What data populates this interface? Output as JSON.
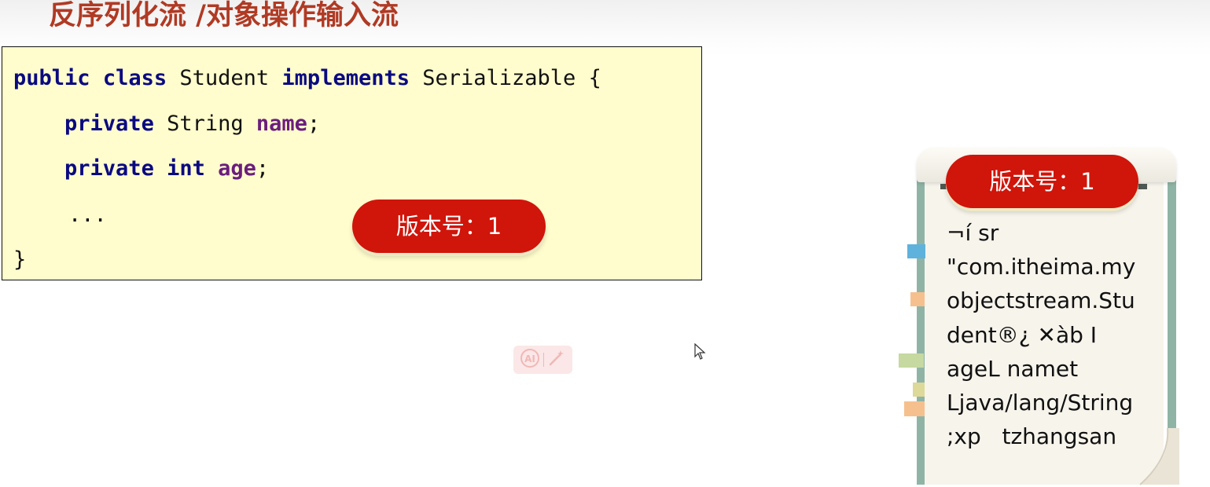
{
  "title": "反序列化流 /对象操作输入流",
  "code": {
    "line1": {
      "kw1": "public",
      "kw2": "class",
      "name": "Student",
      "kw3": "implements",
      "iface": "Serializable",
      "brace": "{"
    },
    "line2": {
      "kw": "private",
      "type": "String",
      "field": "name",
      "semi": ";"
    },
    "line3": {
      "kw": "private",
      "type": "int",
      "field": "age",
      "semi": ";"
    },
    "line4": "...",
    "line5": "}"
  },
  "version_badge": "版本号：1",
  "ai_toolbar": {
    "ai_icon": "ai-icon",
    "magic_icon": "magic-wand-icon"
  },
  "serialized_lines": [
    "¬í sr",
    "\"com.itheima.my",
    "objectstream.Stu",
    "dent®¿ ✕àb I",
    "ageL namet",
    "Ljava/lang/String",
    ";xp   tzhangsan"
  ],
  "colors": {
    "title": "#b03a24",
    "keyword": "#0a0a80",
    "field": "#6a1e7c",
    "badge": "#d0150a",
    "code_background": "#fffccd",
    "scroll_edge": "#8fb4a6"
  }
}
